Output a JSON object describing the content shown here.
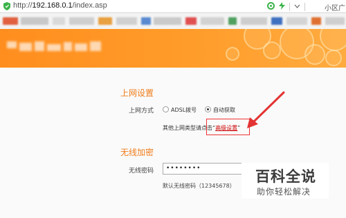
{
  "browser": {
    "url_prefix": "http://",
    "url_host": "192.168.0.1",
    "url_path": "/index.asp",
    "toolbar_right_text": "小区广"
  },
  "section_internet": {
    "title": "上网设置",
    "mode_label": "上网方式",
    "options": [
      {
        "label": "ADSL拨号",
        "selected": false
      },
      {
        "label": "自动获取",
        "selected": true
      }
    ],
    "note_prefix": "其他上网类型请点击“",
    "advanced_link": "高级设置",
    "note_suffix": "”"
  },
  "section_wireless": {
    "title": "无线加密",
    "password_label": "无线密码",
    "password_value": "••••••••",
    "hint": "默认无线密码（12345678）"
  },
  "watermark": {
    "title": "百科全说",
    "subtitle": "助你轻松解决"
  },
  "colors": {
    "header_orange": "#ff9322",
    "section_title": "#f07c1a",
    "annotation_red": "#e33333"
  }
}
